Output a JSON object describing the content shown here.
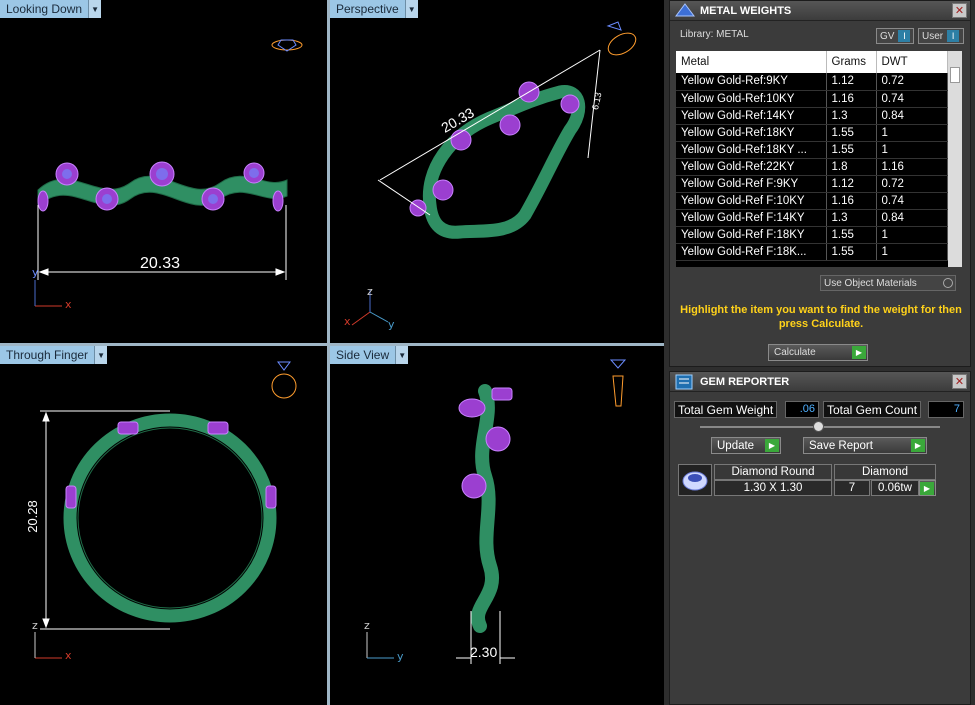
{
  "viewports": {
    "top_left": {
      "label": "Looking Down",
      "dimension": "20.33",
      "axis1": "y",
      "axis2": "x"
    },
    "top_right": {
      "label": "Perspective",
      "dimension": "20.33",
      "dimension2": "6.13",
      "axis1": "z",
      "axis2": "x",
      "axis3": "y"
    },
    "bottom_left": {
      "label": "Through Finger",
      "dimension": "20.28",
      "axis1": "z",
      "axis2": "x"
    },
    "bottom_right": {
      "label": "Side View",
      "dimension": "2.30",
      "axis1": "z",
      "axis2": "y"
    }
  },
  "metal_panel": {
    "title": "METAL WEIGHTS",
    "library_label": "Library: METAL",
    "toggle_gv": "GV",
    "toggle_user": "User",
    "toggle_mark": "I",
    "columns": [
      "Metal",
      "Grams",
      "DWT"
    ],
    "rows": [
      [
        "Yellow Gold-Ref:9KY",
        "1.12",
        "0.72"
      ],
      [
        "Yellow Gold-Ref:10KY",
        "1.16",
        "0.74"
      ],
      [
        "Yellow Gold-Ref:14KY",
        "1.3",
        "0.84"
      ],
      [
        "Yellow Gold-Ref:18KY",
        "1.55",
        "1"
      ],
      [
        "Yellow Gold-Ref:18KY ...",
        "1.55",
        "1"
      ],
      [
        "Yellow Gold-Ref:22KY",
        "1.8",
        "1.16"
      ],
      [
        "Yellow Gold-Ref F:9KY",
        "1.12",
        "0.72"
      ],
      [
        "Yellow Gold-Ref F:10KY",
        "1.16",
        "0.74"
      ],
      [
        "Yellow Gold-Ref F:14KY",
        "1.3",
        "0.84"
      ],
      [
        "Yellow Gold-Ref F:18KY",
        "1.55",
        "1"
      ],
      [
        "Yellow Gold-Ref F:18K...",
        "1.55",
        "1"
      ]
    ],
    "use_object_materials": "Use Object Materials",
    "message": "Highlight the item you want to find the weight for then press Calculate.",
    "calculate_label": "Calculate"
  },
  "gem_panel": {
    "title": "GEM REPORTER",
    "total_weight_label": "Total Gem Weight",
    "total_weight_value": ".06",
    "total_count_label": "Total Gem Count",
    "total_count_value": "7",
    "update_label": "Update",
    "save_label": "Save Report",
    "gem_shape": "Diamond Round",
    "gem_size": "1.30 X 1.30",
    "gem_type": "Diamond",
    "gem_count": "7",
    "gem_weight": "0.06tw"
  },
  "colors": {
    "ring_green": "#2f8f63",
    "gem_purple": "#9b3fd0",
    "dimension_white": "#ffffff",
    "accent_yellow": "#ffd21a"
  }
}
